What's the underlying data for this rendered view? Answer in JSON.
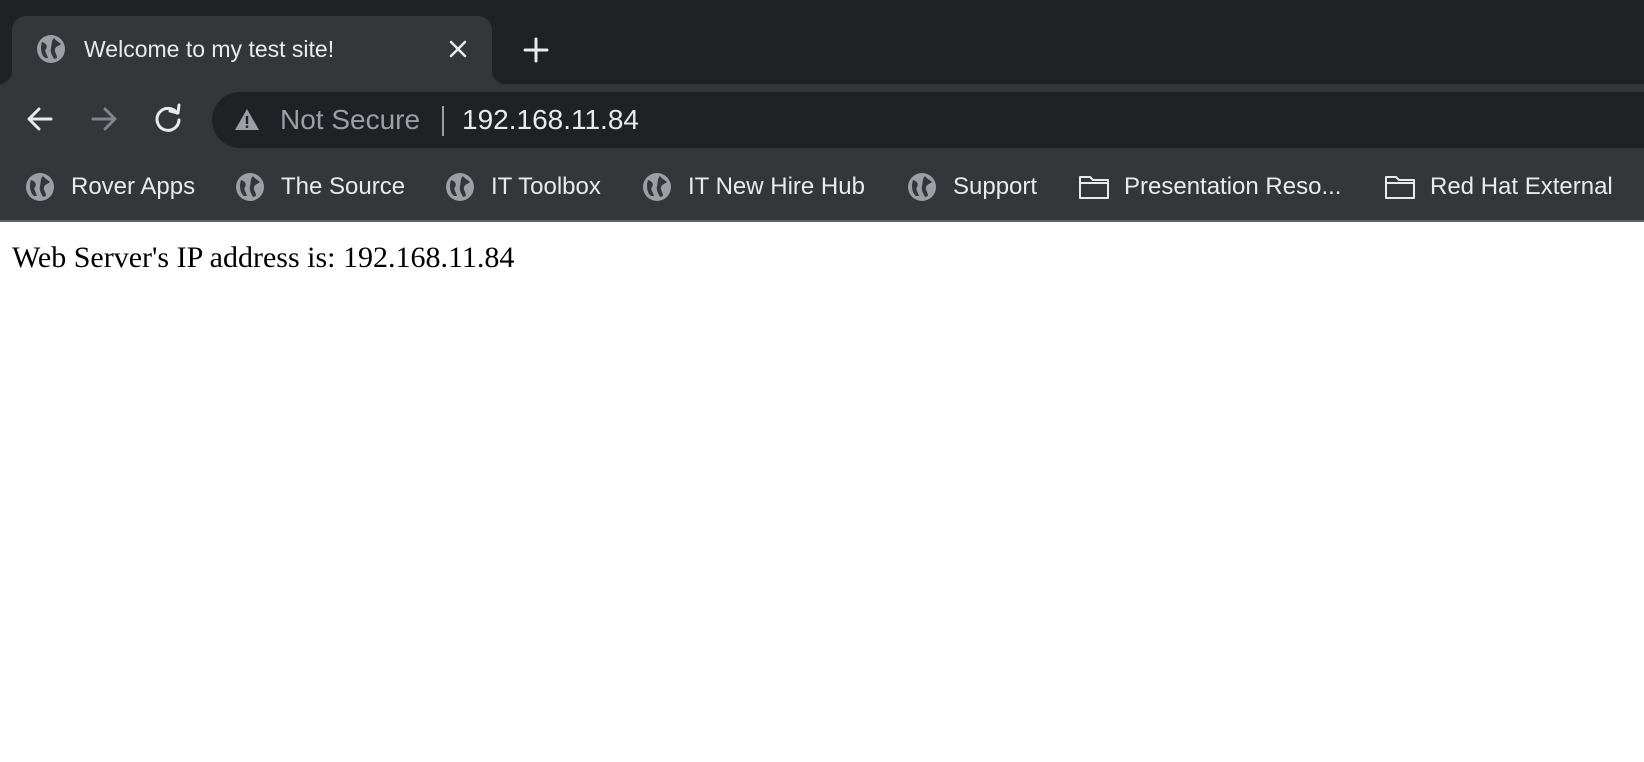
{
  "tab": {
    "title": "Welcome to my test site!"
  },
  "address_bar": {
    "security_label": "Not Secure",
    "url": "192.168.11.84"
  },
  "bookmarks": [
    {
      "label": "Rover Apps",
      "icon": "globe-icon"
    },
    {
      "label": "The Source",
      "icon": "globe-icon"
    },
    {
      "label": "IT Toolbox",
      "icon": "globe-icon"
    },
    {
      "label": "IT New Hire Hub",
      "icon": "globe-icon"
    },
    {
      "label": "Support",
      "icon": "globe-icon"
    },
    {
      "label": "Presentation Reso...",
      "icon": "folder-icon"
    },
    {
      "label": "Red Hat External",
      "icon": "folder-icon"
    }
  ],
  "page": {
    "text": "Web Server's IP address is: 192.168.11.84"
  },
  "colors": {
    "chrome_dark": "#202124",
    "chrome_mid": "#35363a",
    "text_light": "#e8eaed",
    "text_muted": "#9aa0a6"
  }
}
